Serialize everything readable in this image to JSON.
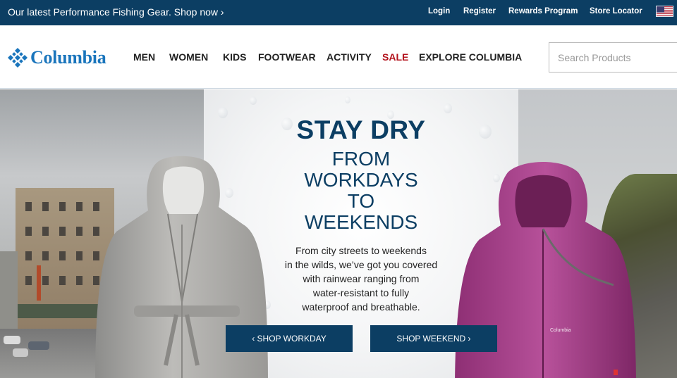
{
  "topbar": {
    "promo": "Our latest Performance Fishing Gear. Shop now ›",
    "links": [
      "Login",
      "Register",
      "Rewards Program",
      "Store Locator"
    ],
    "flag_icon": "us-flag-icon",
    "background": "#0c3e63"
  },
  "header": {
    "logo_text": "Columbia",
    "logo_icon": "columbia-diamond-icon",
    "logo_color": "#1a75bc",
    "nav": [
      "MEN",
      "WOMEN",
      "KIDS",
      "FOOTWEAR",
      "ACTIVITY",
      "SALE",
      "EXPLORE COLUMBIA"
    ],
    "sale_color": "#b3121c",
    "search_placeholder": "Search Products"
  },
  "hero": {
    "title": "STAY DRY",
    "subtitle_lines": [
      "FROM",
      "WORKDAYS",
      "TO",
      "WEEKENDS"
    ],
    "body_lines": [
      "From city streets to weekends",
      "in the wilds, we’ve got you covered",
      "with rainwear ranging from",
      "water-resistant to fully",
      "waterproof and breathable."
    ],
    "buttons": [
      "‹ SHOP WORKDAY",
      "SHOP WEEKEND ›"
    ],
    "coat_logo": "Columbia",
    "accent": "#0c3e63"
  }
}
